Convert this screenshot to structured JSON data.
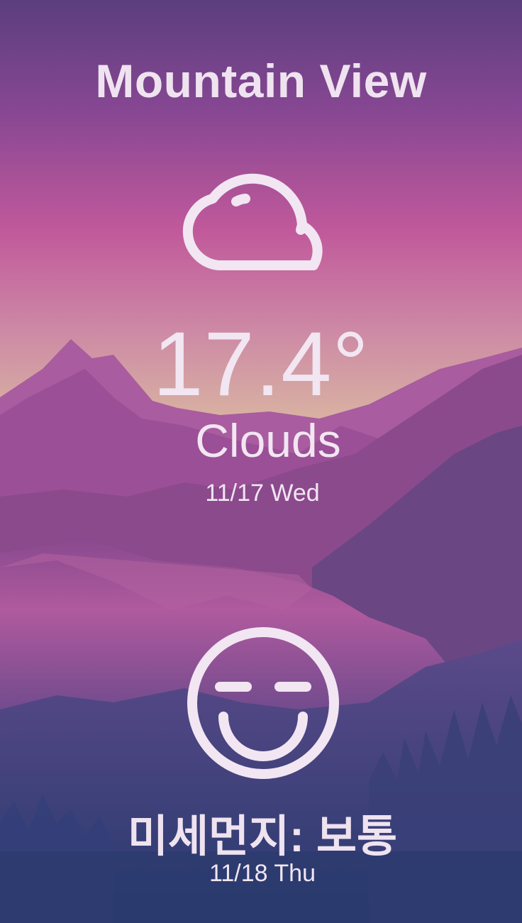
{
  "location": {
    "city": "Mountain View"
  },
  "current": {
    "icon": "cloud-icon",
    "temperature": "17.4°",
    "condition": "Clouds",
    "date": "11/17 Wed"
  },
  "air_quality": {
    "icon": "smiley-face-icon",
    "label": "미세먼지: 보통",
    "date": "11/18 Thu"
  },
  "colors": {
    "sky_top": "#5e3f7e",
    "sky_mid": "#c1599a",
    "horizon": "#d6a7a3",
    "text": "#f1e6f2",
    "mountains": "#9a4a95",
    "forest": "#2c3a70"
  }
}
